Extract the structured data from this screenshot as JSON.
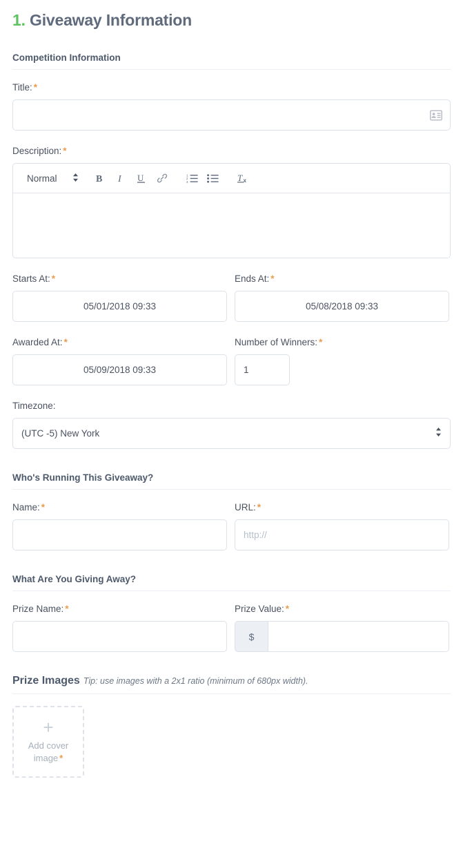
{
  "heading": {
    "number": "1.",
    "title": "Giveaway Information",
    "number_color": "#5cc45e",
    "title_color": "#5f6b7d"
  },
  "required_marker": "*",
  "sections": {
    "competition": {
      "title": "Competition Information",
      "title_label": "Title:",
      "title_value": "",
      "title_icon": "contact-card-icon",
      "description_label": "Description:",
      "description_value": "",
      "editor": {
        "format_select": "Normal",
        "buttons": [
          {
            "name": "bold-icon",
            "label": "B"
          },
          {
            "name": "italic-icon",
            "label": "I"
          },
          {
            "name": "underline-icon",
            "label": "U"
          },
          {
            "name": "link-icon",
            "label": "link"
          },
          {
            "name": "ordered-list-icon",
            "label": "ordered list"
          },
          {
            "name": "bullet-list-icon",
            "label": "bullet list"
          },
          {
            "name": "clear-format-icon",
            "label": "Tx"
          }
        ]
      },
      "starts_at_label": "Starts At:",
      "starts_at_value": "05/01/2018 09:33",
      "ends_at_label": "Ends At:",
      "ends_at_value": "05/08/2018 09:33",
      "awarded_at_label": "Awarded At:",
      "awarded_at_value": "05/09/2018 09:33",
      "winners_label": "Number of Winners:",
      "winners_value": "1",
      "timezone_label": "Timezone:",
      "timezone_value": "(UTC -5) New York"
    },
    "running": {
      "title": "Who's Running This Giveaway?",
      "name_label": "Name:",
      "name_value": "",
      "url_label": "URL:",
      "url_value": "",
      "url_placeholder": "http://"
    },
    "giving_away": {
      "title": "What Are You Giving Away?",
      "prize_name_label": "Prize Name:",
      "prize_name_value": "",
      "prize_value_label": "Prize Value:",
      "prize_value_currency": "$",
      "prize_value_value": ""
    },
    "prize_images": {
      "title": "Prize Images",
      "tip": "Tip: use images with a 2x1 ratio (minimum of 680px width).",
      "uploader_plus": "+",
      "uploader_line1": "Add cover",
      "uploader_line2": "image"
    }
  }
}
